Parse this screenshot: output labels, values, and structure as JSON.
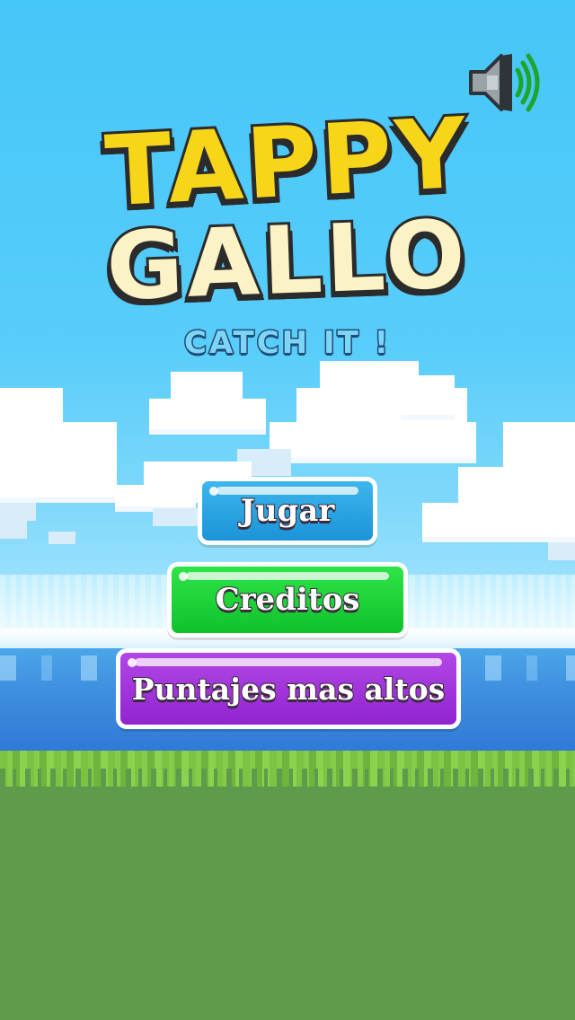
{
  "game": {
    "title_line_1": "TAPPY",
    "title_line_2": "GALLO",
    "tagline": "CATCH IT !"
  },
  "menu": {
    "play_label": "Jugar",
    "credits_label": "Creditos",
    "highscores_label": "Puntajes mas altos"
  },
  "controls": {
    "sound_icon": "speaker-on-icon"
  },
  "colors": {
    "sky": "#45c6f8",
    "sea": "#3f8fe0",
    "grass": "#5e9b4b",
    "title_yellow": "#f7d61a",
    "play_blue": "#1b93d8",
    "credits_green": "#10c22c",
    "highscores_purple": "#9124d0"
  }
}
